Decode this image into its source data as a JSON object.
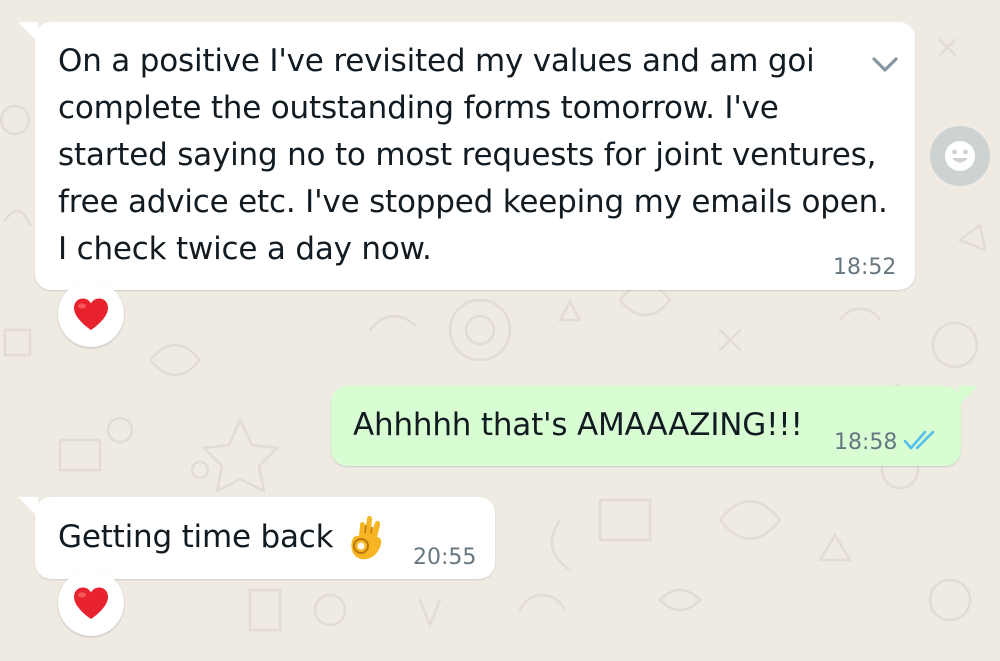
{
  "messages": [
    {
      "direction": "incoming",
      "text": "On a positive I've revisited my values and am goi\ncomplete the outstanding forms tomorrow. I've\nstarted saying no to most requests for joint ventures,\nfree advice etc. I've stopped keeping my emails open.\nI check twice a day now.",
      "time": "18:52",
      "reaction": "red-heart",
      "menu_icon": "chevron-down-icon"
    },
    {
      "direction": "outgoing",
      "text": "Ahhhhh that's AMAAAZING!!!",
      "time": "18:58",
      "status": "read-double-tick-icon"
    },
    {
      "direction": "incoming",
      "text": "Getting time back",
      "emoji": "ok-hand",
      "time": "20:55",
      "reaction": "red-heart"
    }
  ],
  "colors": {
    "wallpaper": "#efeae2",
    "incoming_bubble": "#ffffff",
    "outgoing_bubble": "#d9fdd3",
    "text": "#111b21",
    "timestamp": "#667781",
    "read_ticks": "#53bdeb",
    "heart": "#e8232e"
  },
  "icons": {
    "react": "smiley-icon",
    "menu": "chevron-down-icon"
  }
}
